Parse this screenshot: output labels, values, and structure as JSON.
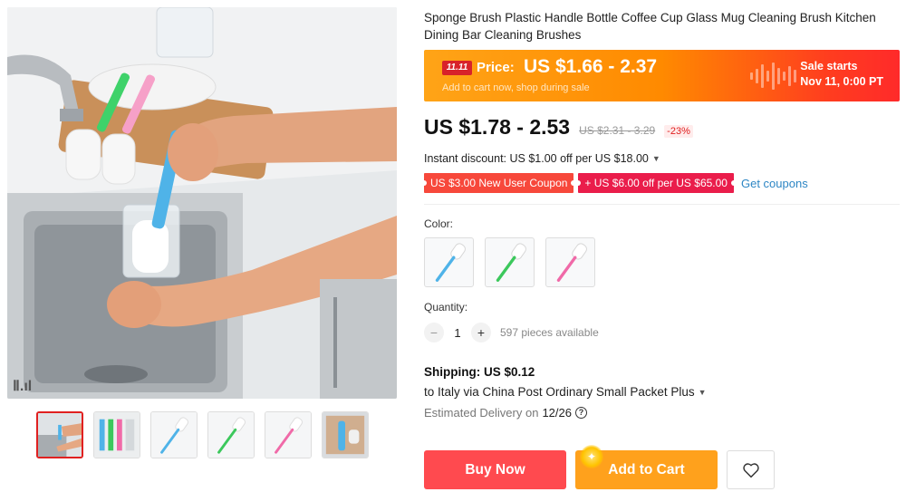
{
  "product": {
    "title": "Sponge Brush Plastic Handle Bottle Coffee Cup Glass Mug Cleaning Brush Kitchen Dining Bar Cleaning Brushes"
  },
  "sale_banner": {
    "badge": "11.11",
    "price_label": "Price:",
    "price": "US $1.66 - 2.37",
    "subtitle": "Add to cart now, shop during sale",
    "starts_line1": "Sale starts",
    "starts_line2": "Nov 11, 0:00 PT"
  },
  "pricing": {
    "price": "US $1.78 - 2.53",
    "original": "US $2.31 - 3.29",
    "discount": "-23%"
  },
  "instant_discount": "Instant discount: US $1.00 off per US $18.00",
  "coupons": {
    "c1": "US $3.00 New User Coupon",
    "c2": "+ US $6.00 off per US $65.00",
    "get": "Get coupons"
  },
  "color": {
    "label": "Color:",
    "options": [
      "blue",
      "green",
      "pink"
    ],
    "swatch_colors": [
      "#4fb3e8",
      "#3cc85c",
      "#f06aa8"
    ]
  },
  "quantity": {
    "label": "Quantity:",
    "minus": "−",
    "plus": "+",
    "value": "1",
    "available": "597 pieces available"
  },
  "shipping": {
    "title": "Shipping: US $0.12",
    "route": "to Italy via China Post Ordinary Small Packet Plus",
    "estimated_label": "Estimated Delivery on",
    "estimated_date": "12/26",
    "help": "?"
  },
  "actions": {
    "buy_now": "Buy Now",
    "add_to_cart": "Add to Cart"
  },
  "gallery": {
    "watermark": "Ⅱ.ıl"
  }
}
